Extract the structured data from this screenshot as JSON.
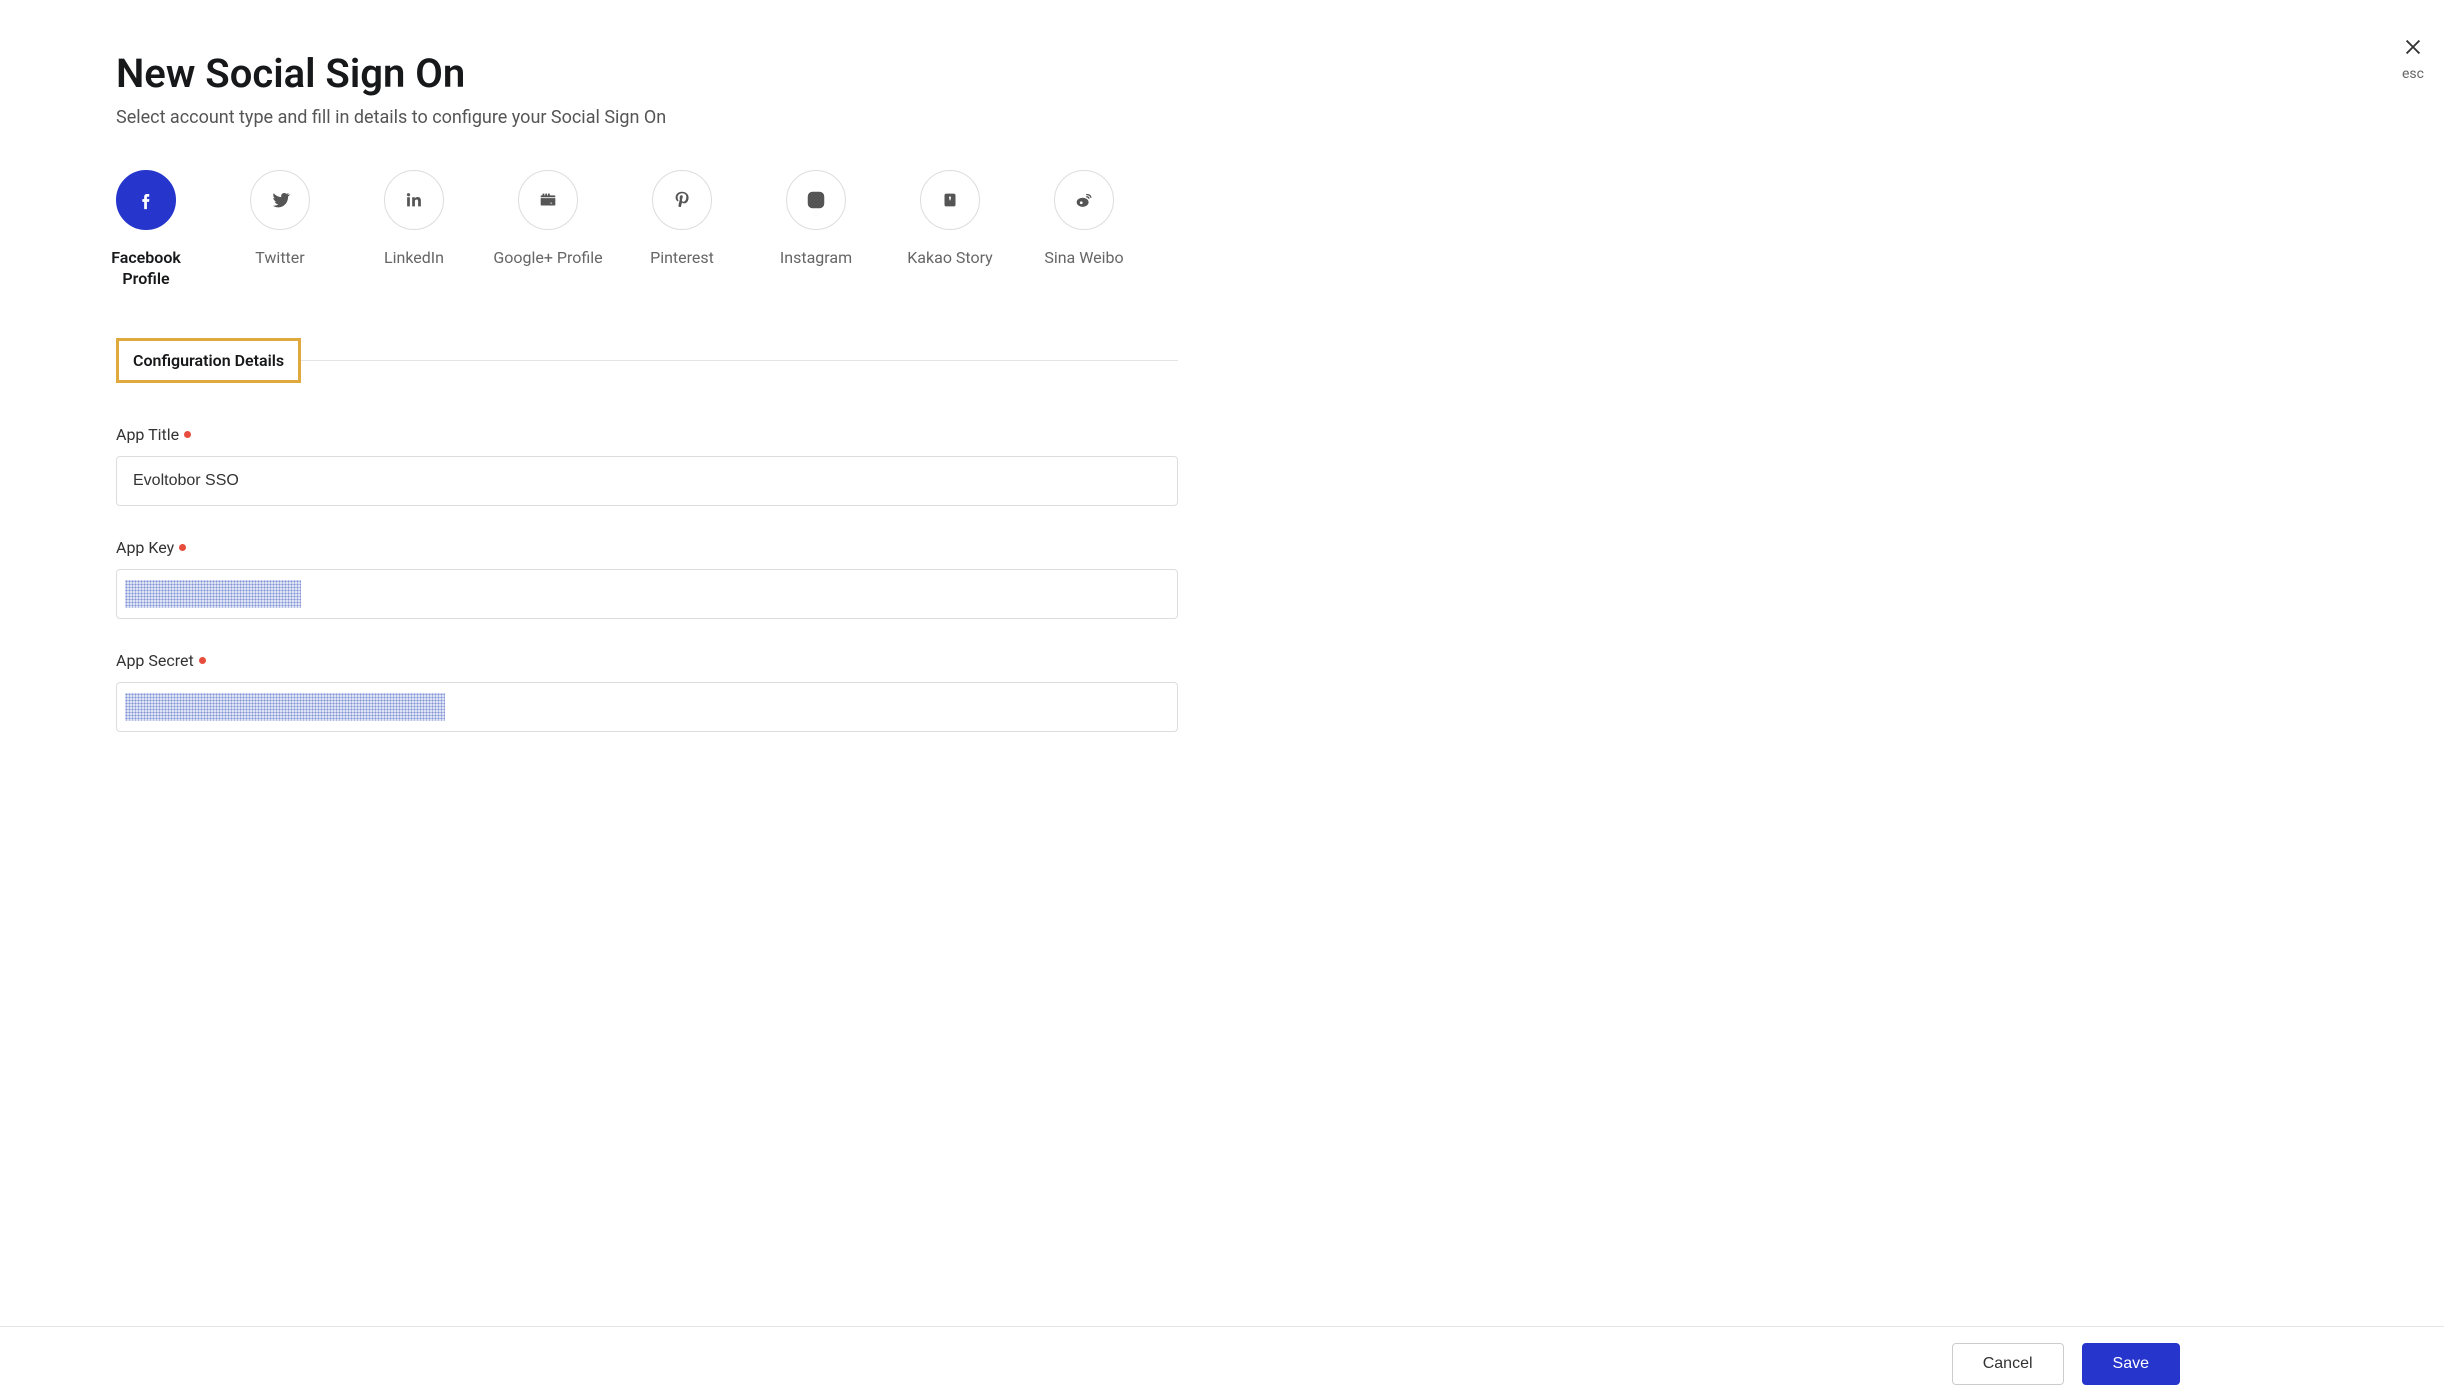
{
  "header": {
    "title": "New Social Sign On",
    "subtitle": "Select account type and fill in details to configure your Social Sign On",
    "close_label": "esc"
  },
  "providers": [
    {
      "id": "facebook",
      "label": "Facebook\nProfile",
      "selected": true
    },
    {
      "id": "twitter",
      "label": "Twitter",
      "selected": false
    },
    {
      "id": "linkedin",
      "label": "LinkedIn",
      "selected": false
    },
    {
      "id": "googleplus",
      "label": "Google+ Profile",
      "selected": false
    },
    {
      "id": "pinterest",
      "label": "Pinterest",
      "selected": false
    },
    {
      "id": "instagram",
      "label": "Instagram",
      "selected": false
    },
    {
      "id": "kakao",
      "label": "Kakao Story",
      "selected": false
    },
    {
      "id": "weibo",
      "label": "Sina Weibo",
      "selected": false
    }
  ],
  "section": {
    "tab_label": "Configuration Details"
  },
  "form": {
    "app_title": {
      "label": "App Title",
      "value": "Evoltobor SSO",
      "required": true
    },
    "app_key": {
      "label": "App Key",
      "value": "",
      "required": true,
      "redacted": "short"
    },
    "app_secret": {
      "label": "App Secret",
      "value": "",
      "required": true,
      "redacted": "long"
    }
  },
  "footer": {
    "cancel_label": "Cancel",
    "save_label": "Save"
  }
}
